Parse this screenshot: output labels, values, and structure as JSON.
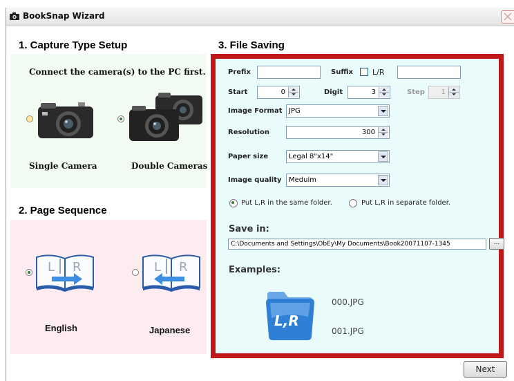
{
  "window": {
    "title": "BookSnap Wizard"
  },
  "capture": {
    "heading": "1. Capture Type Setup",
    "instruction": "Connect the camera(s) to the PC first.",
    "single_label": "Single Camera",
    "double_label": "Double Cameras",
    "selected": "Double Cameras"
  },
  "sequence": {
    "heading": "2. Page Sequence",
    "english_label": "English",
    "japanese_label": "Japanese",
    "book_letters": "L R",
    "selected": "English"
  },
  "saving": {
    "heading": "3. File Saving",
    "prefix_label": "Prefix",
    "prefix_value": "",
    "suffix_label": "Suffix",
    "lr_label": "L/R",
    "suffix_value": "",
    "start_label": "Start",
    "start_value": "0",
    "digit_label": "Digit",
    "digit_value": "3",
    "step_label": "Step",
    "step_value": "1",
    "format_label": "Image Format",
    "format_value": "JPG",
    "resolution_label": "Resolution",
    "resolution_value": "300",
    "paper_label": "Paper size",
    "paper_value": "Legal 8\"x14\"",
    "quality_label": "Image quality",
    "quality_value": "Meduim",
    "same_folder_label": "Put L,R in the same folder.",
    "separate_folder_label": "Put L,R in separate folder.",
    "save_in_label": "Save in:",
    "save_path": "C:\\Documents and Settings\\ObEy\\My Documents\\Book20071107-1345",
    "browse_label": "...",
    "examples_label": "Examples:",
    "folder_icon_text": "L,R",
    "example_files": [
      "000.JPG",
      "001.JPG"
    ]
  },
  "footer": {
    "next_label": "Next"
  },
  "colors": {
    "highlight_border": "#c01818",
    "saving_bg": "#e9fbfb",
    "capture_bg": "#f2fbf2",
    "sequence_bg": "#fcecf0"
  }
}
